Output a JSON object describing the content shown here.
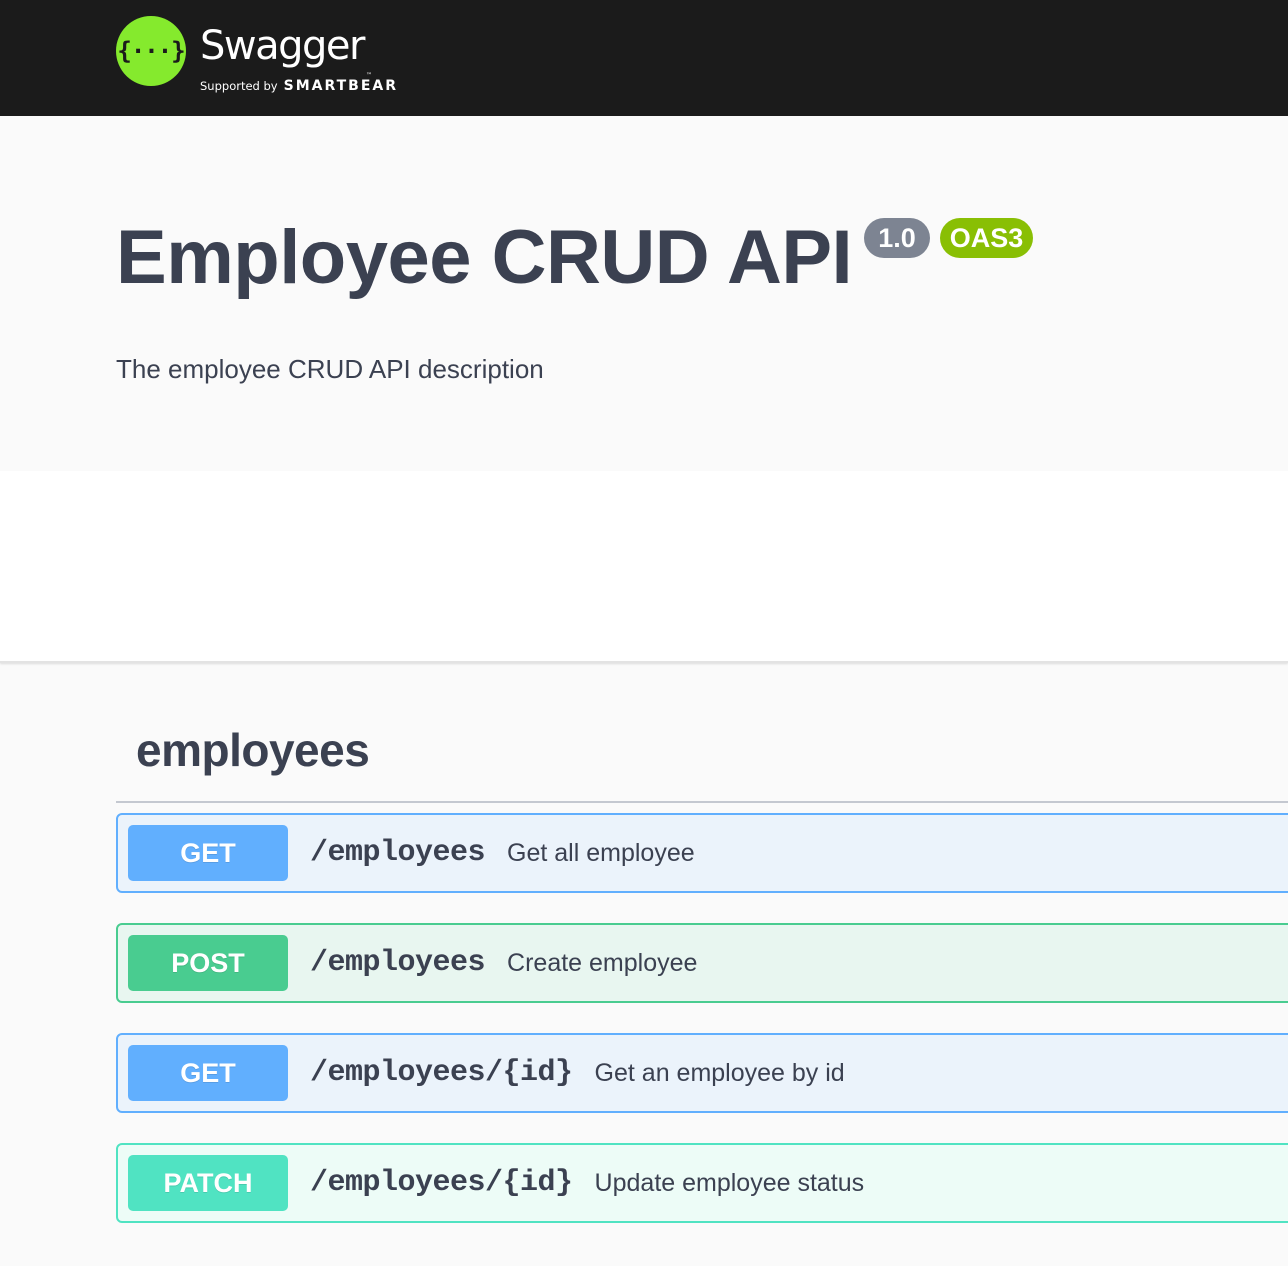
{
  "topbar": {
    "logo_glyph": "{···}",
    "logo_title": "Swagger",
    "logo_tm": "™",
    "supported_by": "Supported by",
    "brand": "SMARTBEAR"
  },
  "info": {
    "title": "Employee CRUD API",
    "version": "1.0",
    "oas_badge": "OAS3",
    "description": "The employee CRUD API description"
  },
  "tag": {
    "name": "employees"
  },
  "operations": [
    {
      "method": "GET",
      "path": "/employees",
      "summary": "Get all employee"
    },
    {
      "method": "POST",
      "path": "/employees",
      "summary": "Create employee"
    },
    {
      "method": "GET",
      "path": "/employees/{id}",
      "summary": "Get an employee by id"
    },
    {
      "method": "PATCH",
      "path": "/employees/{id}",
      "summary": "Update employee status"
    }
  ],
  "colors": {
    "topbar": "#1b1b1b",
    "logo_green": "#85ea2d",
    "get": "#61affe",
    "post": "#49cc90",
    "patch": "#50e3c2",
    "version_badge": "#7d8492",
    "oas_badge": "#89bf04"
  }
}
